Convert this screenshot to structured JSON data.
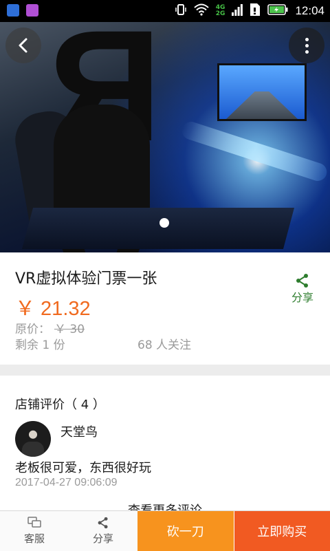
{
  "status_bar": {
    "time": "12:04",
    "net_top": "4G",
    "net_bottom": "2G"
  },
  "product": {
    "title": "VR虚拟体验门票一张",
    "price": "￥ 21.32",
    "orig_label": "原价：",
    "orig_price": "￥ 30",
    "stock": "剩余 1 份",
    "followers": "68 人关注",
    "share_label": "分享"
  },
  "reviews": {
    "heading": "店铺评价（ 4 ）",
    "items": [
      {
        "user": "天堂鸟",
        "text": "老板很可爱，东西很好玩",
        "date": "2017-04-27 09:06:09"
      }
    ],
    "more": "查看更多评论"
  },
  "bottom_bar": {
    "service": "客服",
    "share": "分享",
    "bargain": "砍一刀",
    "buy": "立即购买"
  },
  "colors": {
    "price": "#f06a1f",
    "bargain": "#f7931e",
    "buy": "#f15a22",
    "share_green": "#2e7d2e"
  }
}
